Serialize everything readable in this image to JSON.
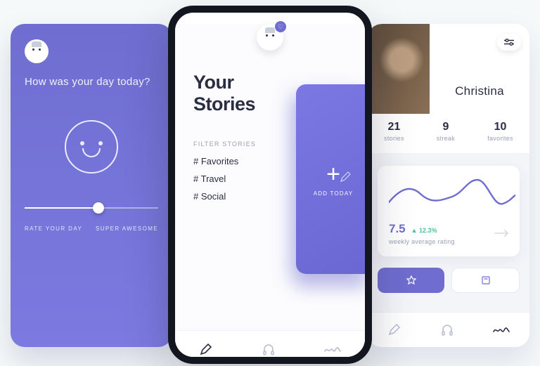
{
  "colors": {
    "accent": "#6f6ed0",
    "dark": "#2b2d42",
    "muted": "#9aa0b4",
    "positive": "#49c39e"
  },
  "left": {
    "question": "How was your day today?",
    "slider_left": "RATE YOUR DAY",
    "slider_right": "SUPER AWESOME",
    "slider_value": 55
  },
  "center": {
    "title_line1": "Your",
    "title_line2": "Stories",
    "filter_heading": "FILTER STORIES",
    "filters": [
      "# Favorites",
      "# Travel",
      "# Social"
    ],
    "card_action": "ADD TODAY",
    "nav": {
      "pen": "write",
      "headphones": "listen",
      "wave": "stats"
    }
  },
  "right": {
    "name": "Christina",
    "stats": [
      {
        "value": "21",
        "label": "stories"
      },
      {
        "value": "9",
        "label": "streak"
      },
      {
        "value": "10",
        "label": "favorites"
      }
    ],
    "score_value": "7.5",
    "score_delta": "▲ 12.3%",
    "score_caption": "weekly average rating"
  },
  "chart_data": {
    "type": "line",
    "title": "weekly average rating",
    "x": [
      0,
      1,
      2,
      3,
      4,
      5,
      6
    ],
    "values": [
      6.5,
      7.8,
      6.8,
      7.0,
      8.6,
      6.4,
      7.2
    ],
    "ylim": [
      5,
      10
    ],
    "summary_value": 7.5,
    "delta_pct": 12.3
  }
}
